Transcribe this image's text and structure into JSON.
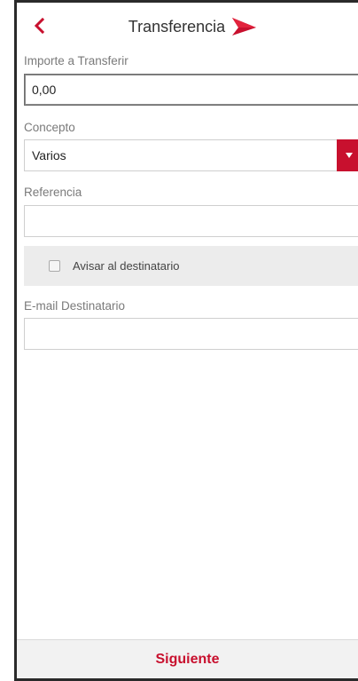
{
  "header": {
    "title": "Transferencia",
    "back_icon": "chevron-left-icon",
    "logo_icon": "brand-arrow-logo-icon"
  },
  "form": {
    "amount": {
      "label": "Importe a Transferir",
      "value": "0,00"
    },
    "concept": {
      "label": "Concepto",
      "selected": "Varios",
      "dropdown_icon": "caret-down-icon"
    },
    "reference": {
      "label": "Referencia",
      "value": ""
    },
    "notify": {
      "label": "Avisar al destinatario",
      "checked": false
    },
    "email": {
      "label": "E-mail Destinatario",
      "value": ""
    }
  },
  "footer": {
    "next_label": "Siguiente"
  },
  "colors": {
    "accent": "#c8102e",
    "panel": "#ececec",
    "footer_bg": "#f2f2f2",
    "label": "#7a7a7a"
  }
}
